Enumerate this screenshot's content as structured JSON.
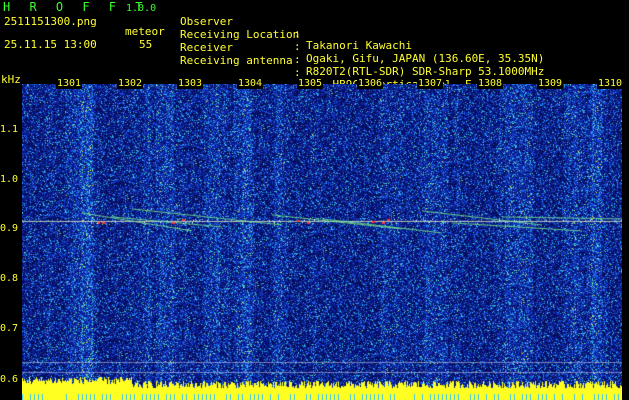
{
  "header": {
    "app_name": "H R O F F T",
    "version": "1.0.0",
    "filename": "2511151300.png",
    "datetime": "25.11.15 13:00",
    "meteor_label": "meteor",
    "meteor_count": "55"
  },
  "info": [
    {
      "label": "Observer",
      "value": "Takanori Kawachi"
    },
    {
      "label": "Receiving Location",
      "value": "Ogaki, Gifu, JAPAN (136.60E, 35.35N)"
    },
    {
      "label": "Receiver",
      "value": "R820T2(RTL-SDR) SDR-Sharp 53.1000MHz"
    },
    {
      "label": "Receiving antenna",
      "value": "2el-HB9CV Vertical (el. E-W)"
    }
  ],
  "axis": {
    "y_unit": "kHz",
    "y_ticks": [
      "1.1",
      "1.0",
      "0.9",
      "0.8",
      "0.7",
      "0.6"
    ],
    "x_ticks": [
      "1301",
      "1302",
      "1303",
      "1304",
      "1305",
      "1306",
      "1307",
      "1308",
      "1309",
      "1310"
    ]
  },
  "colors": {
    "background": "#000000",
    "text_yellow": "#ffff33",
    "text_green": "#39ff2a",
    "spectrogram_base": "#0a1a8a"
  },
  "chart_data": {
    "type": "heatmap",
    "title": "",
    "xlabel": "",
    "ylabel": "kHz",
    "x_ticks": [
      "1301",
      "1302",
      "1303",
      "1304",
      "1305",
      "1306",
      "1307",
      "1308",
      "1309",
      "1310"
    ],
    "y_ticks": [
      1.1,
      1.0,
      0.9,
      0.8,
      0.7,
      0.6
    ],
    "ylim": [
      0.58,
      1.18
    ],
    "carrier_khz": 0.92,
    "grid": true
  }
}
